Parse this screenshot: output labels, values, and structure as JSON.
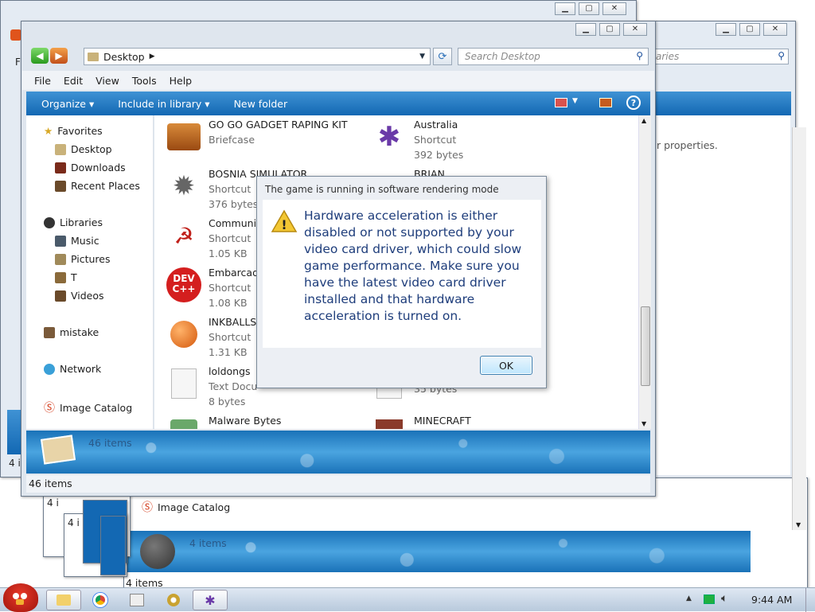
{
  "main_window": {
    "address": "Desktop",
    "search_placeholder": "Search Desktop",
    "menu": [
      "File",
      "Edit",
      "View",
      "Tools",
      "Help"
    ],
    "toolbar": {
      "organize": "Organize",
      "include": "Include in library",
      "new_folder": "New folder"
    },
    "sidebar": {
      "favorites": "Favorites",
      "desktop": "Desktop",
      "downloads": "Downloads",
      "recent": "Recent Places",
      "libraries": "Libraries",
      "music": "Music",
      "pictures": "Pictures",
      "t": "T",
      "videos": "Videos",
      "mistake": "mistake",
      "network": "Network",
      "catalog": "Image Catalog"
    },
    "files": [
      {
        "name": "GO GO GADGET RAPING KIT",
        "sub": "Briefcase",
        "sub2": ""
      },
      {
        "name": "Australia",
        "sub": "Shortcut",
        "sub2": "392 bytes"
      },
      {
        "name": "BOSNIA SIMULATOR",
        "sub": "Shortcut",
        "sub2": "376 bytes"
      },
      {
        "name": "BRIAN",
        "sub": "",
        "sub2": ""
      },
      {
        "name": "Communis",
        "sub": "Shortcut",
        "sub2": "1.05 KB"
      },
      {
        "name": "Embarcad",
        "sub": "Shortcut",
        "sub2": "1.08 KB"
      },
      {
        "name": "INKBALLS",
        "sub": "Shortcut",
        "sub2": "1.31 KB"
      },
      {
        "name": "loldongs",
        "sub": "Text Docu",
        "sub2": "8 bytes"
      },
      {
        "name": "",
        "sub": "",
        "sub2": "35 bytes"
      },
      {
        "name": "Malware Bytes",
        "sub": "",
        "sub2": ""
      },
      {
        "name": "MINECRAFT",
        "sub": "",
        "sub2": ""
      }
    ],
    "details_count": "46 items",
    "status": "46 items"
  },
  "back_window": {
    "search_placeholder": "aries",
    "properties_text": "r properties.",
    "catalog": "Image Catalog",
    "details_count": "4 items",
    "status": "4 items"
  },
  "misc": {
    "left_f": "F",
    "stack_labels": [
      "4 i",
      "4 i",
      "4 i",
      "4 i"
    ]
  },
  "dialog": {
    "title": "The game is running in software rendering mode",
    "message": "Hardware acceleration is either disabled or not supported by your video card driver, which could slow game performance. Make sure you have the latest video card driver installed and that hardware acceleration is turned on.",
    "ok": "OK"
  },
  "taskbar": {
    "clock": "9:44 AM"
  },
  "colors": {
    "accent": "#1368b3",
    "titlebar": "#dfe6ee",
    "dialog_text": "#1e3d7b"
  }
}
